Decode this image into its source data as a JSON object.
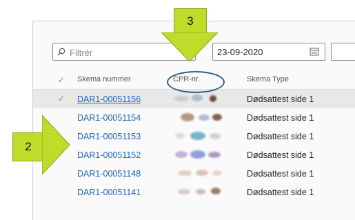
{
  "filter": {
    "placeholder": "Filtrér"
  },
  "date_filter": {
    "value": "23-09-2020"
  },
  "table": {
    "headers": {
      "id": "Skema nummer",
      "cpr": "CPR-nr.",
      "type": "Skema Type"
    },
    "rows": [
      {
        "id": "DAR1-00051156",
        "type": "Dødsattest side 1"
      },
      {
        "id": "DAR1-00051154",
        "type": "Dødsattest side 1"
      },
      {
        "id": "DAR1-00051153",
        "type": "Dødsattest side 1"
      },
      {
        "id": "DAR1-00051152",
        "type": "Dødsattest side 1"
      },
      {
        "id": "DAR1-00051148",
        "type": "Dødsattest side 1"
      },
      {
        "id": "DAR1-00051141",
        "type": "Dødsattest side 1"
      }
    ]
  },
  "callouts": {
    "two": "2",
    "three": "3"
  },
  "colors": {
    "callout": "#bfdc2a",
    "link": "#2064c0",
    "oval": "#2f6080"
  },
  "icons": {
    "filter": "search-icon",
    "date": "calendar-icon",
    "check": "checkmark-icon"
  }
}
